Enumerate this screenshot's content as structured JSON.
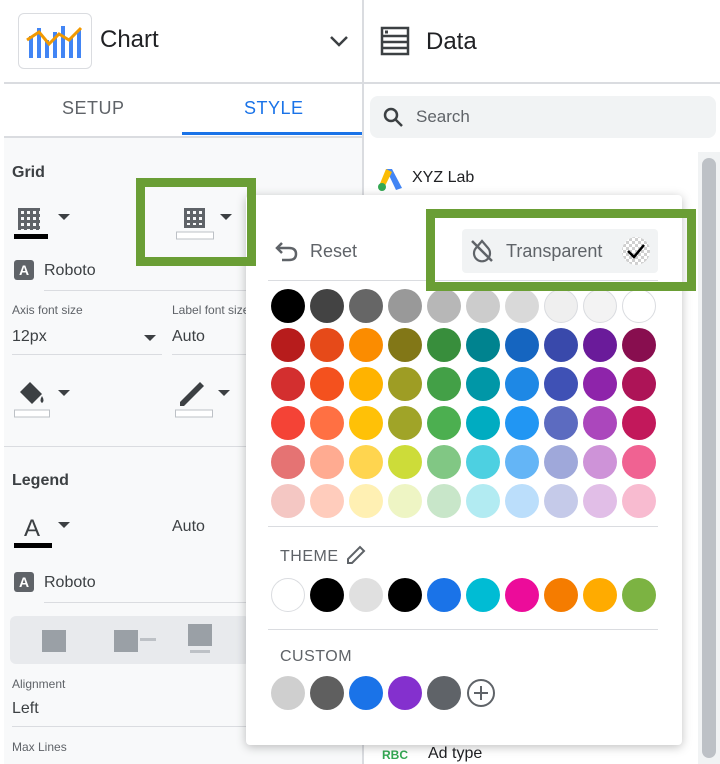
{
  "left_panel": {
    "chart_title": "Chart",
    "tabs": {
      "setup": "SETUP",
      "style": "STYLE"
    },
    "grid": {
      "section": "Grid",
      "font": "Roboto",
      "axis_font_size_label": "Axis font size",
      "axis_font_size_value": "12px",
      "label_font_size_label": "Label font size",
      "label_font_size_value": "Auto"
    },
    "legend": {
      "section": "Legend",
      "size_value": "Auto",
      "font": "Roboto",
      "alignment_label": "Alignment",
      "alignment_value": "Left",
      "max_lines_label": "Max Lines"
    }
  },
  "right_panel": {
    "title": "Data",
    "search_placeholder": "Search",
    "source": "XYZ Lab",
    "field_type_badge": "RBC",
    "field": "Ad type"
  },
  "color_popover": {
    "reset_label": "Reset",
    "transparent_label": "Transparent",
    "palette": [
      [
        "#000000",
        "#434343",
        "#666666",
        "#999999",
        "#b7b7b7",
        "#cccccc",
        "#d9d9d9",
        "#efefef",
        "#f3f3f3",
        "#ffffff"
      ],
      [
        "#b71c1c",
        "#e64a19",
        "#fb8c00",
        "#827717",
        "#388e3c",
        "#00838f",
        "#1565c0",
        "#3949ab",
        "#6a1b9a",
        "#880e4f"
      ],
      [
        "#d32f2f",
        "#f4511e",
        "#ffb300",
        "#9e9d24",
        "#43a047",
        "#0097a7",
        "#1e88e5",
        "#3f51b5",
        "#8e24aa",
        "#ad1457"
      ],
      [
        "#f44336",
        "#ff7043",
        "#ffc107",
        "#a0a428",
        "#4caf50",
        "#00acc1",
        "#2196f3",
        "#5c6bc0",
        "#ab47bc",
        "#c2185b"
      ],
      [
        "#e57373",
        "#ffab91",
        "#ffd54f",
        "#cddc39",
        "#81c784",
        "#4dd0e1",
        "#64b5f6",
        "#9fa8da",
        "#ce93d8",
        "#f06292"
      ],
      [
        "#f4c7c3",
        "#ffccbc",
        "#fff0b3",
        "#eef5c4",
        "#c8e6c9",
        "#b2ebf2",
        "#bbdefb",
        "#c5cae9",
        "#e1bee7",
        "#f8bbd0"
      ]
    ],
    "theme_label": "THEME",
    "theme_colors": [
      "#ffffff",
      "#000000",
      "#e0e0e0",
      "#000000",
      "#1a73e8",
      "#00bcd4",
      "#ec0c9a",
      "#f57c00",
      "#ffab00",
      "#7cb342"
    ],
    "custom_label": "CUSTOM",
    "custom_colors": [
      "#cfcfcf",
      "#5f5f5f",
      "#1a73e8",
      "#8430ce",
      "#5f6368"
    ]
  },
  "colors": {
    "accent": "#1a73e8",
    "highlight": "#6a9e35"
  }
}
